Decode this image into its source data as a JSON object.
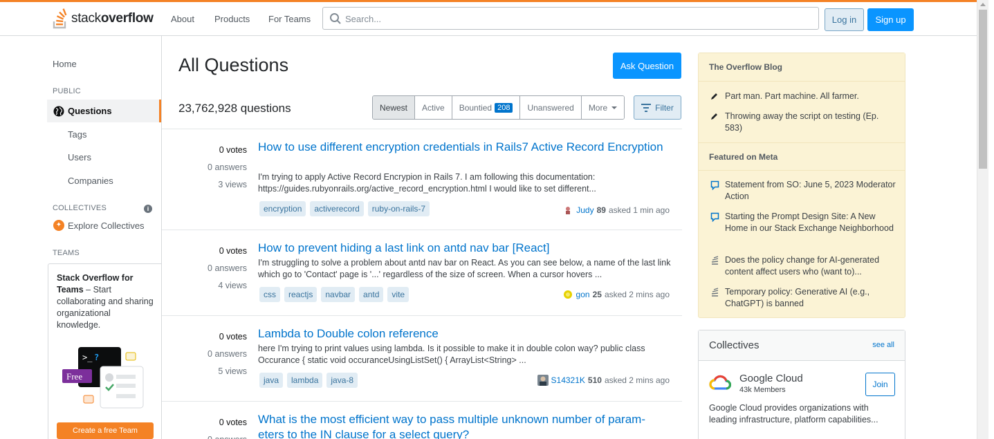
{
  "header": {
    "logo_text_light": "stack",
    "logo_text_bold": "overflow",
    "nav": [
      "About",
      "Products",
      "For Teams"
    ],
    "search_placeholder": "Search...",
    "login_label": "Log in",
    "signup_label": "Sign up"
  },
  "leftnav": {
    "home": "Home",
    "public_label": "PUBLIC",
    "questions": "Questions",
    "tags": "Tags",
    "users": "Users",
    "companies": "Companies",
    "collectives_label": "COLLECTIVES",
    "explore_collectives": "Explore Collectives",
    "teams_label": "TEAMS",
    "teams_title": "Stack Overflow for Teams",
    "teams_desc": " – Start collaborating and sharing organizational knowledge.",
    "teams_free": "Free",
    "teams_button": "Create a free Team"
  },
  "main": {
    "title": "All Questions",
    "ask_button": "Ask Question",
    "question_count": "23,762,928 questions",
    "filters": [
      "Newest",
      "Active",
      "Bountied",
      "Unanswered",
      "More"
    ],
    "bountied_count": "208",
    "filter_button": "Filter",
    "questions": [
      {
        "votes": "0 votes",
        "answers": "0 answers",
        "views": "3 views",
        "title": "How to use different encryption credentials in Rails7 Active Record Encryption",
        "excerpt": "I'm trying to apply Active Record Encrypion in Rails 7. I am following this documentation: https://guides.rubyonrails.org/active_record_encryption.html I would like to set different...",
        "tags": [
          "encryption",
          "activerecord",
          "ruby-on-rails-7"
        ],
        "user": "Judy",
        "rep": "89",
        "asked": "asked 1 min ago"
      },
      {
        "votes": "0 votes",
        "answers": "0 answers",
        "views": "4 views",
        "title": "How to prevent hiding a last link on antd nav bar [React]",
        "excerpt": "I'm struggling to solve a problem about antd nav bar on React. As you can see below, a name of the last link which go to 'Contact' page is '...' regardless of the size of screen. When a cursor hovers ...",
        "tags": [
          "css",
          "reactjs",
          "navbar",
          "antd",
          "vite"
        ],
        "user": "gon",
        "rep": "25",
        "asked": "asked 2 mins ago"
      },
      {
        "votes": "0 votes",
        "answers": "0 answers",
        "views": "5 views",
        "title": "Lambda to Double colon reference",
        "excerpt": "here I'm trying to print values using lambda. Is it possible to make it in double colon way? public class Occurance { static void occuranceUsingListSet() { ArrayList<String> ...",
        "tags": [
          "java",
          "lambda",
          "java-8"
        ],
        "user": "S14321K",
        "rep": "510",
        "asked": "asked 2 mins ago"
      },
      {
        "votes": "0 votes",
        "answers": "0 answers",
        "title": "What is the most efficient way to pass multiple unknown number of param- eters to the IN clause for a select query?"
      }
    ]
  },
  "sidebar": {
    "blog_title": "The Overflow Blog",
    "blog_items": [
      "Part man. Part machine. All farmer.",
      "Throwing away the script on testing (Ep. 583)"
    ],
    "meta_title": "Featured on Meta",
    "meta_items": [
      "Statement from SO: June 5, 2023 Moderator Action",
      "Starting the Prompt Design Site: A New Home in our Stack Exchange Neighborhood",
      "Does the policy change for AI-generated content affect users who (want to)...",
      "Temporary policy: Generative AI (e.g., ChatGPT) is banned"
    ],
    "collectives_title": "Collectives",
    "see_all": "see all",
    "collective_name": "Google Cloud",
    "collective_members": "43k Members",
    "join": "Join",
    "collective_desc": "Google Cloud provides organizations with leading infrastructure, platform capabilities..."
  }
}
